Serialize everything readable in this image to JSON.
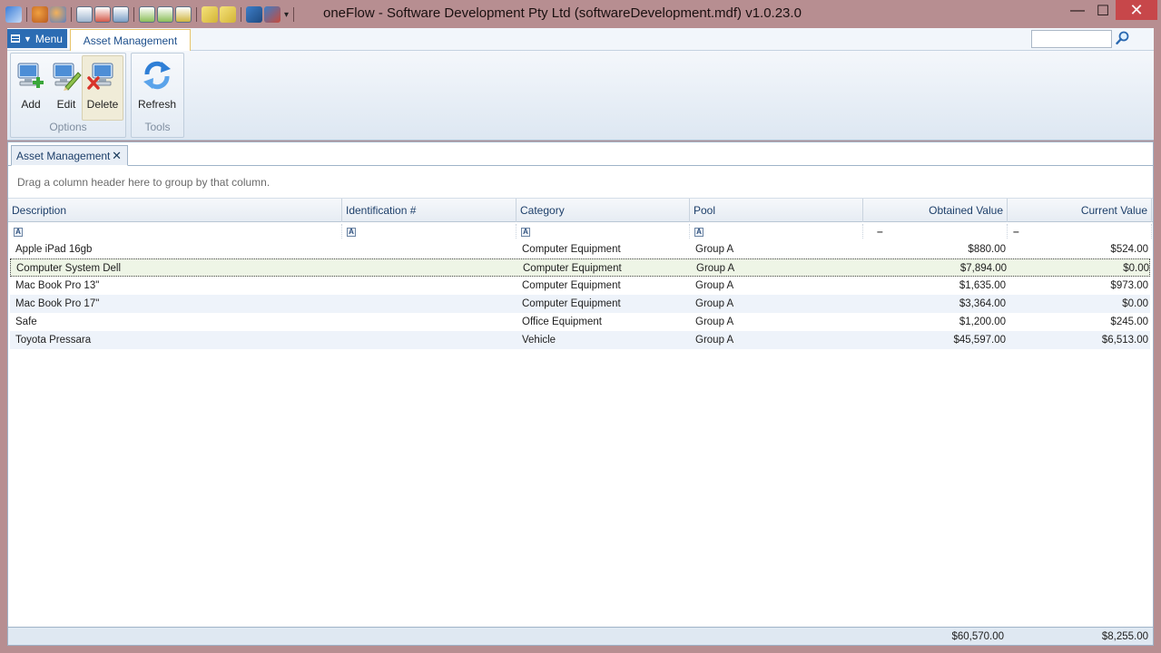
{
  "window": {
    "title": "oneFlow - Software Development Pty Ltd (softwareDevelopment.mdf) v1.0.23.0",
    "minimize": "—",
    "maximize": "☐",
    "close": "✕"
  },
  "quick_access": {
    "icons": [
      "app-icon",
      "users-icon",
      "user-icon",
      "report-icon",
      "report-icon",
      "report-icon",
      "report-icon",
      "report-icon",
      "report-icon",
      "notes-icon",
      "notes-icon",
      "book-icon",
      "book-icon",
      "dropdown-icon"
    ]
  },
  "ribbon": {
    "menu_label": "Menu",
    "tab_label": "Asset Management",
    "options_group": {
      "label": "Options",
      "add": "Add",
      "edit": "Edit",
      "delete": "Delete"
    },
    "tools_group": {
      "label": "Tools",
      "refresh": "Refresh"
    }
  },
  "doc_tab": {
    "label": "Asset Management",
    "close": "✕"
  },
  "group_panel": {
    "text": "Drag a column header here to group by that column."
  },
  "grid": {
    "columns": [
      "Description",
      "Identification #",
      "Category",
      "Pool",
      "Obtained Value",
      "Current Value"
    ],
    "rows": [
      {
        "description": "Apple iPad 16gb",
        "identification": "",
        "category": "Computer Equipment",
        "pool": "Group A",
        "obtained": "$880.00",
        "current": "$524.00"
      },
      {
        "description": "Computer System Dell",
        "identification": "",
        "category": "Computer Equipment",
        "pool": "Group A",
        "obtained": "$7,894.00",
        "current": "$0.00"
      },
      {
        "description": "Mac Book Pro 13\"",
        "identification": "",
        "category": "Computer Equipment",
        "pool": "Group A",
        "obtained": "$1,635.00",
        "current": "$973.00"
      },
      {
        "description": "Mac Book Pro 17\"",
        "identification": "",
        "category": "Computer Equipment",
        "pool": "Group A",
        "obtained": "$3,364.00",
        "current": "$0.00"
      },
      {
        "description": "Safe",
        "identification": "",
        "category": "Office Equipment",
        "pool": "Group A",
        "obtained": "$1,200.00",
        "current": "$245.00"
      },
      {
        "description": "Toyota Pressara",
        "identification": "",
        "category": "Vehicle",
        "pool": "Group A",
        "obtained": "$45,597.00",
        "current": "$6,513.00"
      }
    ],
    "totals": {
      "obtained": "$60,570.00",
      "current": "$8,255.00"
    },
    "filter_icon_text": "A",
    "filter_minus": "–"
  }
}
